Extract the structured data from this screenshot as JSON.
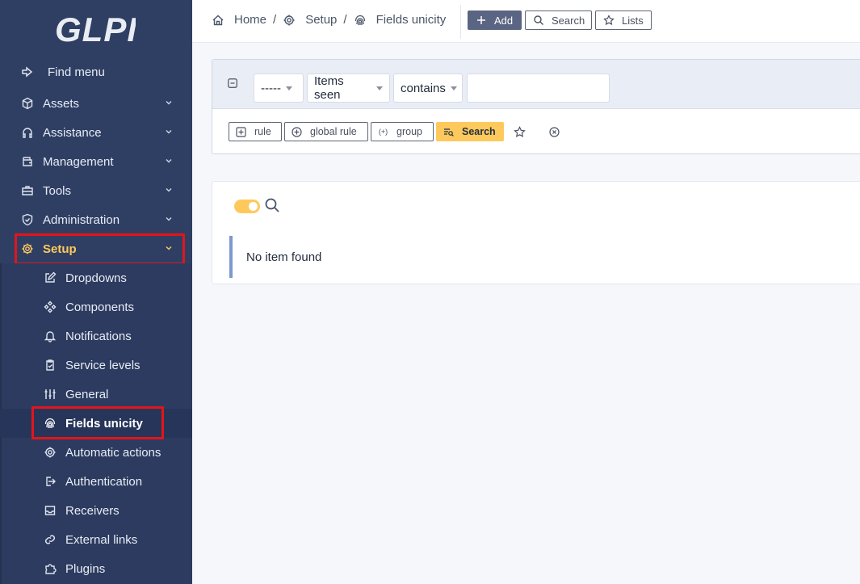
{
  "app": {
    "logo_text": "GLPI"
  },
  "sidebar": {
    "find_menu": "Find menu",
    "items": [
      {
        "label": "Assets",
        "icon": "cube-icon"
      },
      {
        "label": "Assistance",
        "icon": "headset-icon"
      },
      {
        "label": "Management",
        "icon": "wallet-icon"
      },
      {
        "label": "Tools",
        "icon": "briefcase-icon"
      },
      {
        "label": "Administration",
        "icon": "shield-check-icon"
      },
      {
        "label": "Setup",
        "icon": "gear-icon",
        "active": true
      }
    ],
    "setup_children": [
      {
        "label": "Dropdowns",
        "icon": "edit-icon"
      },
      {
        "label": "Components",
        "icon": "components-icon"
      },
      {
        "label": "Notifications",
        "icon": "bell-icon"
      },
      {
        "label": "Service levels",
        "icon": "clipboard-check-icon"
      },
      {
        "label": "General",
        "icon": "adjustments-icon"
      },
      {
        "label": "Fields unicity",
        "icon": "fingerprint-icon",
        "active": true
      },
      {
        "label": "Automatic actions",
        "icon": "gear-icon"
      },
      {
        "label": "Authentication",
        "icon": "login-icon"
      },
      {
        "label": "Receivers",
        "icon": "inbox-icon"
      },
      {
        "label": "External links",
        "icon": "link-icon"
      },
      {
        "label": "Plugins",
        "icon": "puzzle-icon"
      }
    ]
  },
  "breadcrumb": {
    "home": "Home",
    "setup": "Setup",
    "current": "Fields unicity",
    "separator": "/"
  },
  "header_actions": {
    "add": "Add",
    "search": "Search",
    "lists": "Lists"
  },
  "search": {
    "link_select": "-----",
    "field_select": "Items seen",
    "operator_select": "contains",
    "value": "",
    "buttons": {
      "rule": "rule",
      "global_rule": "global rule",
      "group": "group",
      "search": "Search"
    },
    "group_icon_text": "(+)"
  },
  "results": {
    "empty_message": "No item found"
  },
  "colors": {
    "sidebar_bg": "#2f3f64",
    "accent": "#fec95c",
    "highlight": "#e3151a"
  }
}
